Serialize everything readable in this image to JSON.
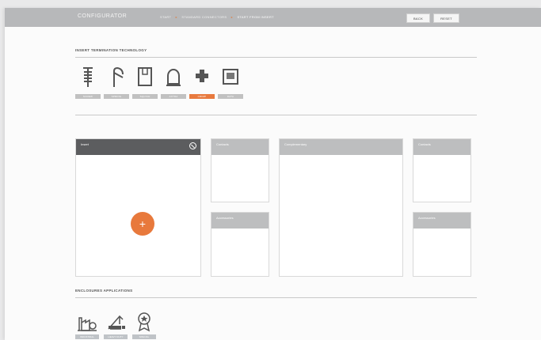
{
  "header": {
    "title": "CONFIGURATOR",
    "breadcrumbs": [
      "START",
      "STANDARD CONNECTORS",
      "START FROM INSERT"
    ],
    "back_label": "BACK",
    "reset_label": "RESET"
  },
  "termination": {
    "title": "INSERT TERMINATION TECHNOLOGY",
    "items": [
      {
        "label": "SCREW",
        "icon": "screw-icon",
        "active": false
      },
      {
        "label": "SPRING",
        "icon": "spring-icon",
        "active": false
      },
      {
        "label": "SQUICH",
        "icon": "squich-icon",
        "active": false
      },
      {
        "label": "AXTRA",
        "icon": "axtra-icon",
        "active": false
      },
      {
        "label": "CRIMP",
        "icon": "crimp-icon",
        "active": true
      },
      {
        "label": "DATA",
        "icon": "data-icon",
        "active": false
      }
    ]
  },
  "panels": {
    "insert": "Insert",
    "contacts": "Contacts",
    "accessories_left": "Accessories",
    "complementary": "Complementary",
    "contacts_right": "Contacts",
    "accessories_right": "Accessories"
  },
  "add_label": "+",
  "enclosures": {
    "title": "ENCLOSURES APPLICATIONS",
    "items": [
      {
        "label": "INDUSTRIAL",
        "icon": "factory-icon"
      },
      {
        "label": "HEAVY DUTY",
        "icon": "crane-icon"
      },
      {
        "label": "SPECIAL",
        "icon": "award-icon"
      }
    ]
  },
  "colors": {
    "accent": "#e8793c",
    "header": "#b7b8ba",
    "panel_head_dark": "#5c5d5f",
    "panel_head": "#bdbebf"
  }
}
